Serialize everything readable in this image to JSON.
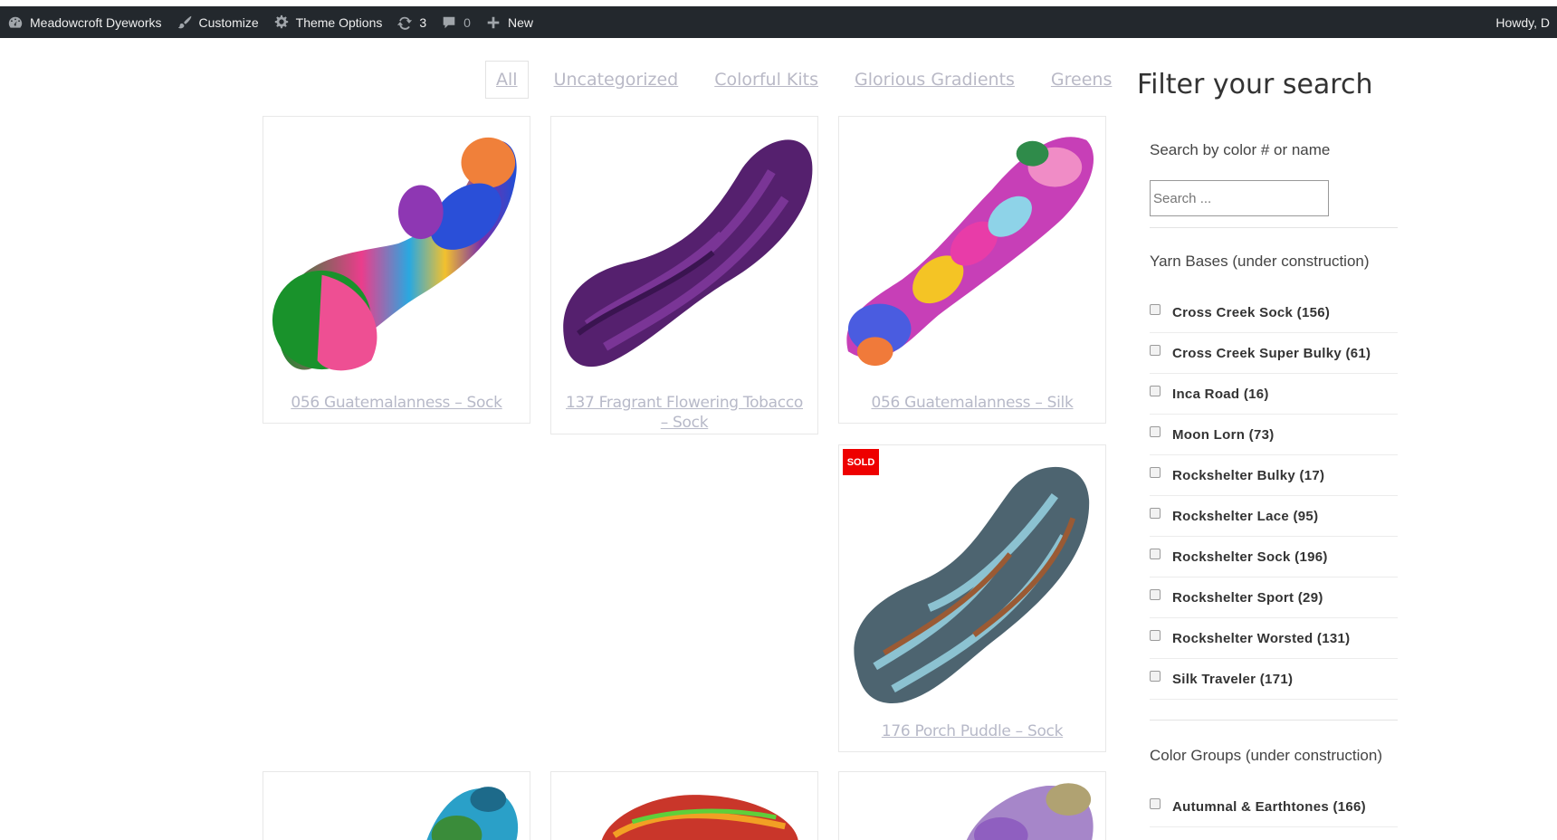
{
  "adminbar": {
    "site_name": "Meadowcroft Dyeworks",
    "customize": "Customize",
    "theme_options": "Theme Options",
    "updates_count": "3",
    "comments_count": "0",
    "new_label": "New",
    "howdy": "Howdy, D"
  },
  "tabs": [
    "All",
    "Uncategorized",
    "Colorful Kits",
    "Glorious Gradients",
    "Greens"
  ],
  "active_tab": "All",
  "products": [
    {
      "title": "056 Guatemalanness – Sock"
    },
    {
      "title": "137 Fragrant Flowering Tobacco – Sock"
    },
    {
      "title": "056 Guatemalanness – Silk"
    },
    {
      "title": "176 Porch Puddle – Sock",
      "badge": "SOLD"
    }
  ],
  "sidebar": {
    "title": "Filter your search",
    "search_label": "Search by color # or name",
    "search_placeholder": "Search ...",
    "yarn_bases_label": "Yarn Bases (under construction)",
    "yarn_bases": [
      "Cross Creek Sock (156)",
      "Cross Creek Super Bulky (61)",
      "Inca Road (16)",
      "Moon Lorn (73)",
      "Rockshelter Bulky (17)",
      "Rockshelter Lace (95)",
      "Rockshelter Sock (196)",
      "Rockshelter Sport (29)",
      "Rockshelter Worsted (131)",
      "Silk Traveler (171)"
    ],
    "color_groups_label": "Color Groups (under construction)",
    "color_groups": [
      "Autumnal & Earthtones (166)"
    ]
  }
}
